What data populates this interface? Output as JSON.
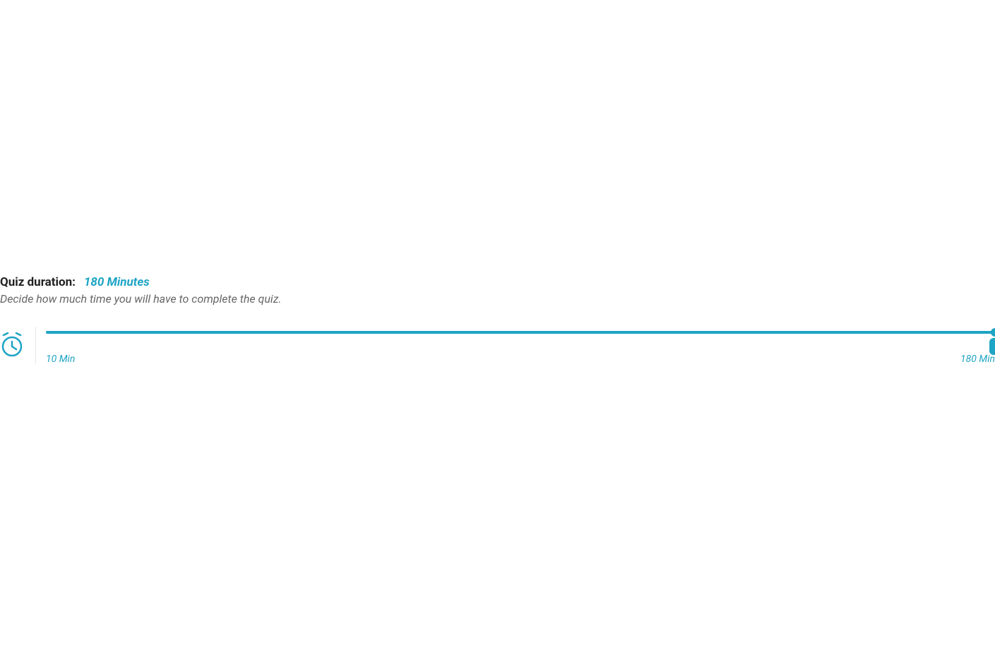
{
  "duration": {
    "label": "Quiz duration:",
    "value": "180 Minutes",
    "description": "Decide how much time you will have to complete the quiz.",
    "min_label": "10 Min",
    "max_label": "180 Min",
    "min": 10,
    "max": 180,
    "current": 180
  },
  "colors": {
    "accent": "#1ea4c4"
  }
}
